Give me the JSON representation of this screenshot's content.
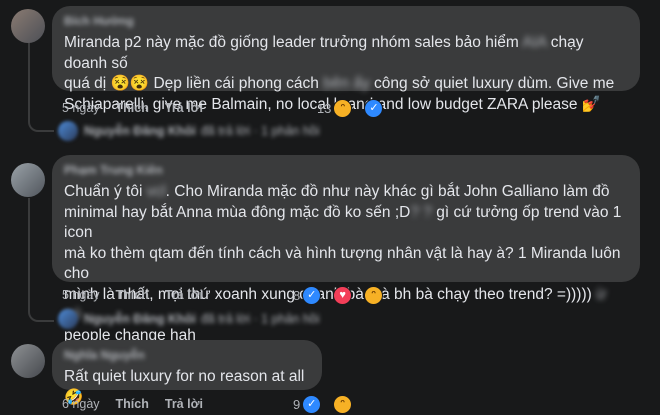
{
  "comments": [
    {
      "author": "Bích Hường",
      "text_parts": [
        "Miranda p2 này mặc đồ giống leader trưởng nhóm sales bảo hiểm ",
        "AIA",
        " chạy doanh số\nquá dị 😵😵 Dẹp liền cái phong cách ",
        "bên ấy",
        " công sở quiet luxury dùm. Give me\nSchiaparelli, give me Balmain, no local brand and low budget ZARA please 💅"
      ],
      "time": "5 ngày",
      "like_label": "Thích",
      "reply_label": "Trả lời",
      "reaction_count": "13",
      "reactions": [
        "laugh-icon",
        "like-icon"
      ],
      "replies_author": "Nguyễn Đăng Khôi",
      "replies_text": "đã trả lời · 1 phản hồi"
    },
    {
      "author": "Phạm Trung Kiên",
      "text_parts": [
        "Chuẩn ý tôi ",
        "vcl",
        ". Cho Miranda mặc đồ như này khác gì bắt John Galliano làm đồ\nminimal hay bắt Anna mùa đông mặc đồ ko sến ;D",
        "? ?",
        " gì cứ tưởng ốp trend vào 1 icon\nmà ko thèm qtam đến tính cách và hình tượng nhân vật là hay à? 1 Miranda luôn cho\nmình là nhất, mọi thứ xoanh xung quanh bà mà bh bà chạy theo trend? =)))))",
        " ừ nó",
        "\npeople change hah"
      ],
      "time": "5 ngày",
      "like_label": "Thích",
      "reply_label": "Trả lời",
      "reaction_count": "8",
      "reactions": [
        "like-icon",
        "heart-icon",
        "laugh-icon"
      ],
      "replies_author": "Nguyễn Đăng Khôi",
      "replies_text": "đã trả lời · 1 phản hồi"
    },
    {
      "author": "Nghĩa Nguyễn",
      "text_parts": [
        "Rất quiet luxury for no reason at all 🤣"
      ],
      "time": "6 ngày",
      "like_label": "Thích",
      "reply_label": "Trả lời",
      "reaction_count": "9",
      "reactions": [
        "like-icon",
        "laugh-icon"
      ]
    }
  ]
}
